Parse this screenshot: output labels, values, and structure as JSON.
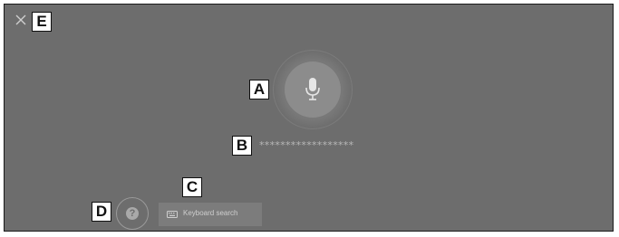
{
  "dialog": {
    "recognized_text": "******************",
    "keyboard_search_label": "Keyboard search",
    "help_glyph": "?"
  },
  "callouts": {
    "a": "A",
    "b": "B",
    "c": "C",
    "d": "D",
    "e": "E"
  },
  "icons": {
    "close": "close-icon",
    "mic": "microphone-icon",
    "help": "question-mark-icon",
    "keyboard": "keyboard-icon"
  },
  "colors": {
    "background": "#6d6d6d",
    "mic_button": "#8c8c8c",
    "text": "#b8b8b8"
  }
}
